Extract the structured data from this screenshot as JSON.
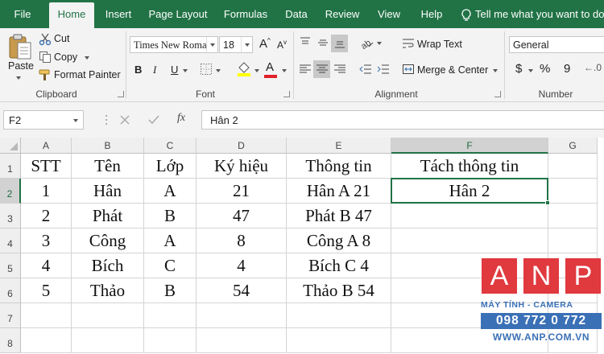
{
  "tabs": [
    "File",
    "Home",
    "Insert",
    "Page Layout",
    "Formulas",
    "Data",
    "Review",
    "View",
    "Help"
  ],
  "active_tab": "Home",
  "tell_me": "Tell me what you want to do",
  "clipboard": {
    "paste": "Paste",
    "cut": "Cut",
    "copy": "Copy",
    "format_painter": "Format Painter",
    "label": "Clipboard"
  },
  "font": {
    "name": "Times New Roma",
    "size": "18",
    "bold": "B",
    "italic": "I",
    "underline": "U",
    "font_color_letter": "A",
    "label": "Font"
  },
  "alignment": {
    "wrap_text": "Wrap Text",
    "merge_center": "Merge & Center",
    "label": "Alignment"
  },
  "number": {
    "format": "General",
    "currency": "$",
    "percent": "%",
    "comma": "9",
    "label": "Number"
  },
  "formula_bar": {
    "name_box": "F2",
    "fx": "fx",
    "value": "Hân 2"
  },
  "sheet": {
    "columns": [
      "A",
      "B",
      "C",
      "D",
      "E",
      "F",
      "G"
    ],
    "rows": [
      "1",
      "2",
      "3",
      "4",
      "5",
      "6",
      "7",
      "8"
    ],
    "selected_cell": "F2",
    "cells": [
      [
        "STT",
        "Tên",
        "Lớp",
        "Ký hiệu",
        "Thông tin",
        "Tách thông tin",
        ""
      ],
      [
        "1",
        "Hân",
        "A",
        "21",
        "Hân A 21",
        "Hân 2",
        ""
      ],
      [
        "2",
        "Phát",
        "B",
        "47",
        "Phát B 47",
        "",
        ""
      ],
      [
        "3",
        "Công",
        "A",
        "8",
        "Công A 8",
        "",
        ""
      ],
      [
        "4",
        "Bích",
        "C",
        "4",
        "Bích C 4",
        "",
        ""
      ],
      [
        "5",
        "Thảo",
        "B",
        "54",
        "Thảo B 54",
        "",
        ""
      ],
      [
        "",
        "",
        "",
        "",
        "",
        "",
        ""
      ],
      [
        "",
        "",
        "",
        "",
        "",
        "",
        ""
      ]
    ]
  },
  "watermark": {
    "letters": [
      "A",
      "N",
      "P"
    ],
    "tagline": "MÁY TÍNH - CAMERA",
    "phone": "098 772 0 772",
    "url": "WWW.ANP.COM.VN"
  },
  "colors": {
    "excel_green": "#217346",
    "watermark_blue": "#3a70b6",
    "watermark_red": "#e0393e"
  }
}
